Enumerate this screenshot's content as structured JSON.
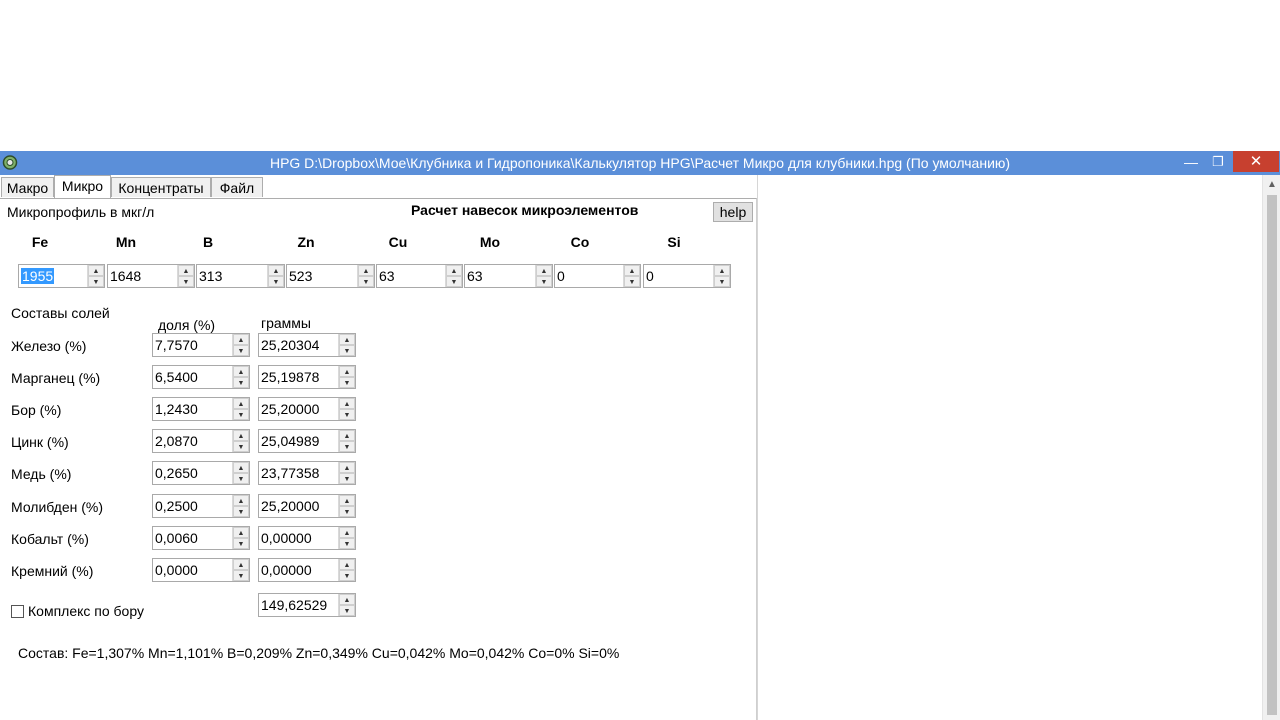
{
  "window": {
    "title": "HPG D:\\Dropbox\\Мое\\Клубника и Гидропоника\\Калькулятор HPG\\Расчет Микро для клубники.hpg (По умолчанию)",
    "minimize": "—",
    "maximize": "❐",
    "close": "✕"
  },
  "tabs": [
    {
      "label": "Макро"
    },
    {
      "label": "Микро"
    },
    {
      "label": "Концентраты"
    },
    {
      "label": "Файл"
    }
  ],
  "micro": {
    "profile_label": "Микропрофиль в мкг/л",
    "heading": "Расчет навесок микроэлементов",
    "help": "help",
    "elements": [
      {
        "symbol": "Fe",
        "value": "1955"
      },
      {
        "symbol": "Mn",
        "value": "1648"
      },
      {
        "symbol": "B",
        "value": "313"
      },
      {
        "symbol": "Zn",
        "value": "523"
      },
      {
        "symbol": "Cu",
        "value": "63"
      },
      {
        "symbol": "Mo",
        "value": "63"
      },
      {
        "symbol": "Co",
        "value": "0"
      },
      {
        "symbol": "Si",
        "value": "0"
      }
    ],
    "salts_label": "Составы солей",
    "share_header": "доля (%)",
    "grams_header": "граммы",
    "salts": [
      {
        "name": "Железо (%)",
        "share": "7,7570",
        "grams": "25,20304"
      },
      {
        "name": "Марганец (%)",
        "share": "6,5400",
        "grams": "25,19878"
      },
      {
        "name": "Бор (%)",
        "share": "1,2430",
        "grams": "25,20000"
      },
      {
        "name": "Цинк (%)",
        "share": "2,0870",
        "grams": "25,04989"
      },
      {
        "name": "Медь (%)",
        "share": "0,2650",
        "grams": "23,77358"
      },
      {
        "name": "Молибден (%)",
        "share": "0,2500",
        "grams": "25,20000"
      },
      {
        "name": "Кобальт (%)",
        "share": "0,0060",
        "grams": "0,00000"
      },
      {
        "name": "Кремний (%)",
        "share": "0,0000",
        "grams": "0,00000"
      }
    ],
    "boron_complex_label": "Комплекс по бору",
    "boron_complex_checked": false,
    "total_grams": "149,62529",
    "composition": "Состав: Fe=1,307% Mn=1,101% B=0,209% Zn=0,349% Cu=0,042% Mo=0,042% Co=0% Si=0%"
  },
  "colors": {
    "titlebar": "#5b8fd9",
    "close_button": "#c7402f",
    "selection": "#3399ff"
  }
}
